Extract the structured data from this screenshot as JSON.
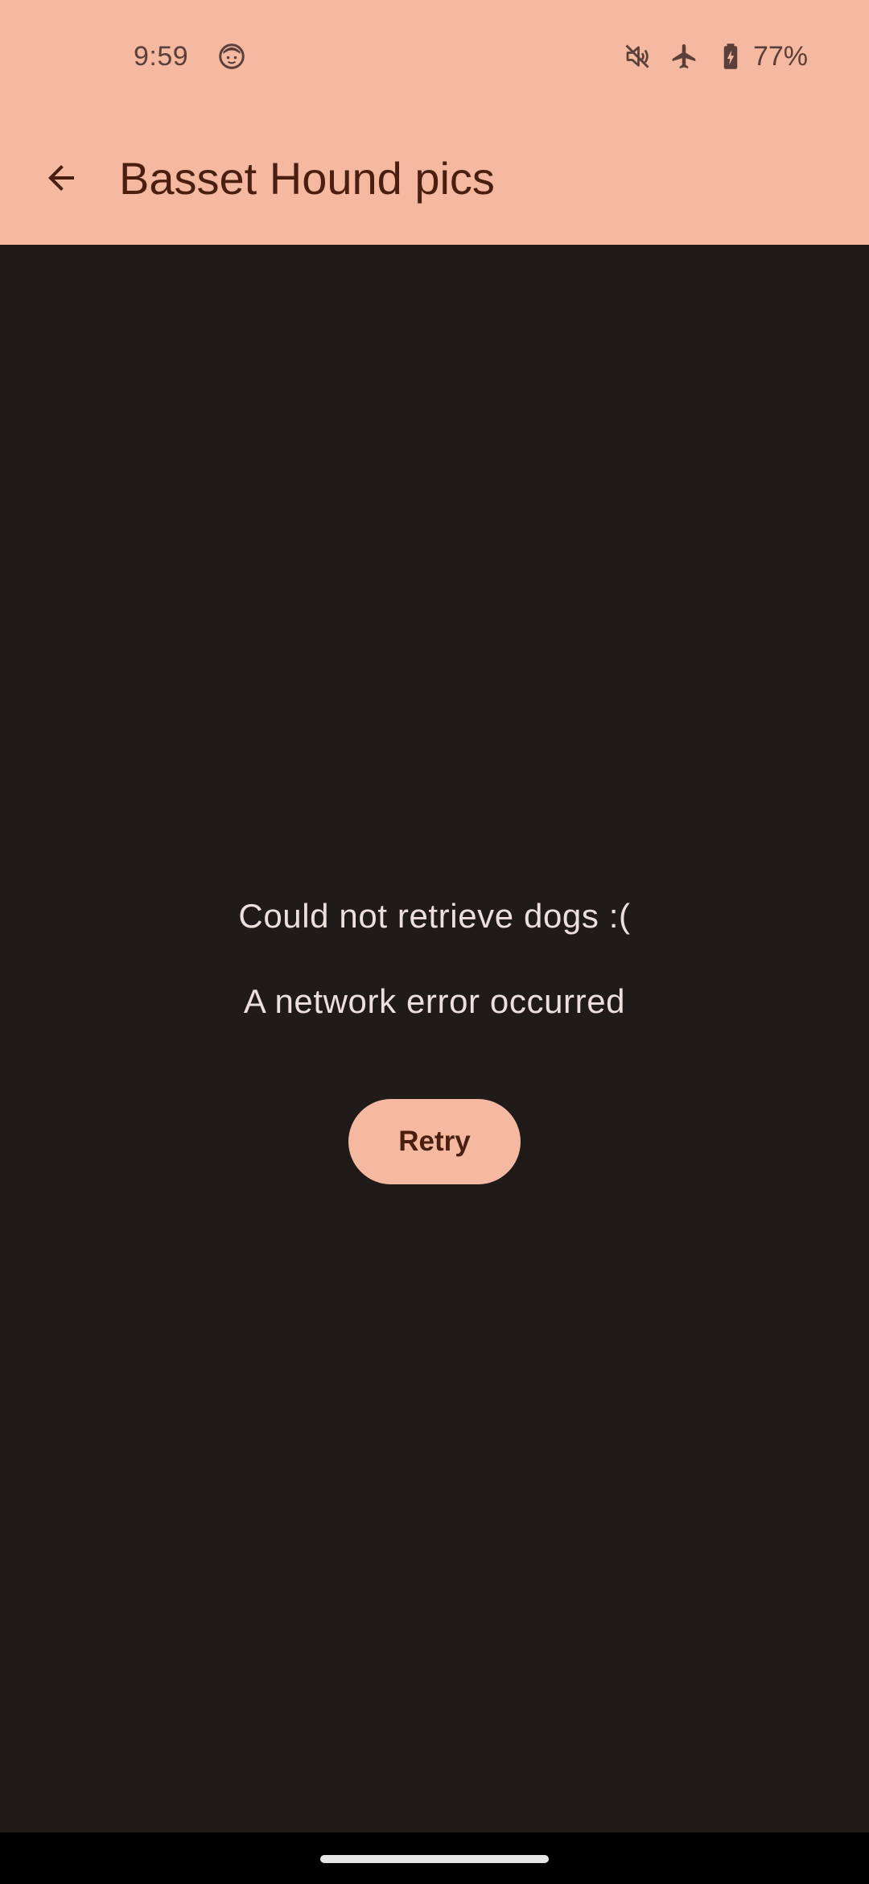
{
  "status_bar": {
    "time": "9:59",
    "left_icon": "face-icon",
    "icons": [
      "mute-icon",
      "airplane-icon",
      "battery-charging-icon"
    ],
    "battery_percent": "77%"
  },
  "app_bar": {
    "back_icon": "arrow-back-icon",
    "title": "Basset Hound pics"
  },
  "error": {
    "title": "Could not retrieve dogs :(",
    "detail": "A network error occurred",
    "retry_label": "Retry"
  },
  "colors": {
    "primary_container": "#f5b9a2",
    "on_primary_container": "#4a1f0f",
    "background": "#201a18",
    "on_background": "#ede0dc"
  }
}
